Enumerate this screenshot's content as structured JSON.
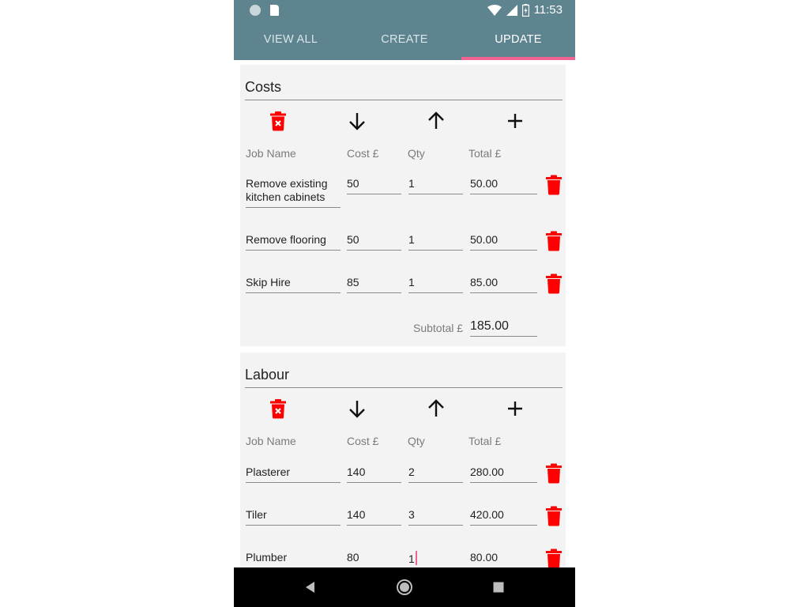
{
  "status_bar": {
    "time": "11:53"
  },
  "tabs": [
    {
      "label": "VIEW ALL"
    },
    {
      "label": "CREATE"
    },
    {
      "label": "UPDATE",
      "active": true
    }
  ],
  "colors": {
    "toolbar": "#5e8490",
    "accent": "#f06292",
    "delete": "#ff0000",
    "card_bg": "#f3f3f3"
  },
  "costs": {
    "title": "Costs",
    "headers": {
      "job_name": "Job Name",
      "cost": "Cost £",
      "qty": "Qty",
      "total": "Total £"
    },
    "rows": [
      {
        "job_name_1": "Remove existing",
        "job_name_2": "kitchen cabinets",
        "cost": "50",
        "qty": "1",
        "total": "50.00"
      },
      {
        "job_name": "Remove flooring",
        "cost": "50",
        "qty": "1",
        "total": "50.00"
      },
      {
        "job_name": "Skip Hire",
        "cost": "85",
        "qty": "1",
        "total": "85.00"
      }
    ],
    "subtotal_label": "Subtotal £",
    "subtotal_value": "185.00"
  },
  "labour": {
    "title": "Labour",
    "headers": {
      "job_name": "Job Name",
      "cost": "Cost £",
      "qty": "Qty",
      "total": "Total £"
    },
    "rows": [
      {
        "job_name": "Plasterer",
        "cost": "140",
        "qty": "2",
        "total": "280.00"
      },
      {
        "job_name": "Tiler",
        "cost": "140",
        "qty": "3",
        "total": "420.00"
      },
      {
        "job_name": "Plumber",
        "cost": "80",
        "qty": "1",
        "total": "80.00"
      }
    ]
  },
  "icons": {
    "section_actions": [
      "delete-section-icon",
      "move-down-icon",
      "move-up-icon",
      "add-row-icon"
    ],
    "row_action": "trash-icon",
    "nav": [
      "back-icon",
      "home-icon",
      "recents-icon"
    ]
  }
}
